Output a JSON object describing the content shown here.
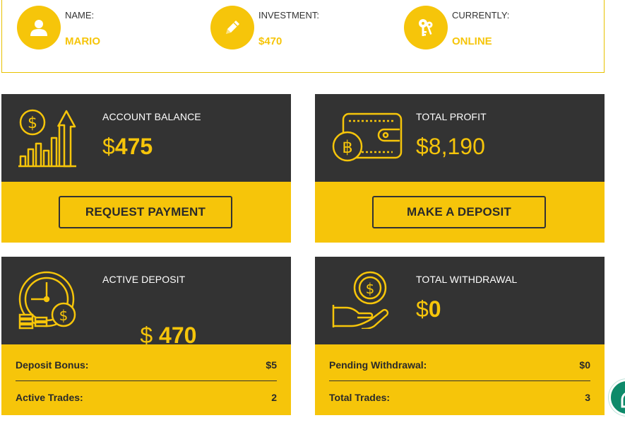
{
  "info_bar": {
    "items": [
      {
        "label": "NAME:",
        "value": "MARIO",
        "icon": "user-icon"
      },
      {
        "label": "INVESTMENT:",
        "value": "$470",
        "icon": "pencil-icon"
      },
      {
        "label": "CURRENTLY:",
        "value": "ONLINE",
        "icon": "keys-icon"
      }
    ]
  },
  "cards": {
    "account_balance": {
      "title": "ACCOUNT BALANCE",
      "currency": "$",
      "amount": "475",
      "button": "REQUEST PAYMENT",
      "icon": "balance-growth-icon"
    },
    "total_profit": {
      "title": "TOTAL PROFIT",
      "currency": "$",
      "amount": "8,190",
      "button": "MAKE A DEPOSIT",
      "icon": "wallet-bitcoin-icon"
    },
    "active_deposit": {
      "title": "ACTIVE DEPOSIT",
      "currency": "$ ",
      "amount": "470",
      "icon": "clock-coins-icon",
      "rows": [
        {
          "label": "Deposit Bonus:",
          "value": "$5"
        },
        {
          "label": "Active Trades:",
          "value": "2"
        }
      ]
    },
    "total_withdrawal": {
      "title": "TOTAL WITHDRAWAL",
      "currency": "$",
      "amount": "0",
      "icon": "hand-coin-icon",
      "rows": [
        {
          "label": "Pending Withdrawal:",
          "value": "$0"
        },
        {
          "label": "Total Trades:",
          "value": "3"
        }
      ]
    }
  },
  "colors": {
    "accent": "#f6c50a",
    "dark": "#333333",
    "text": "#2a2a2a"
  },
  "chat_widget": {
    "icon": "chat-bubble-icon"
  }
}
